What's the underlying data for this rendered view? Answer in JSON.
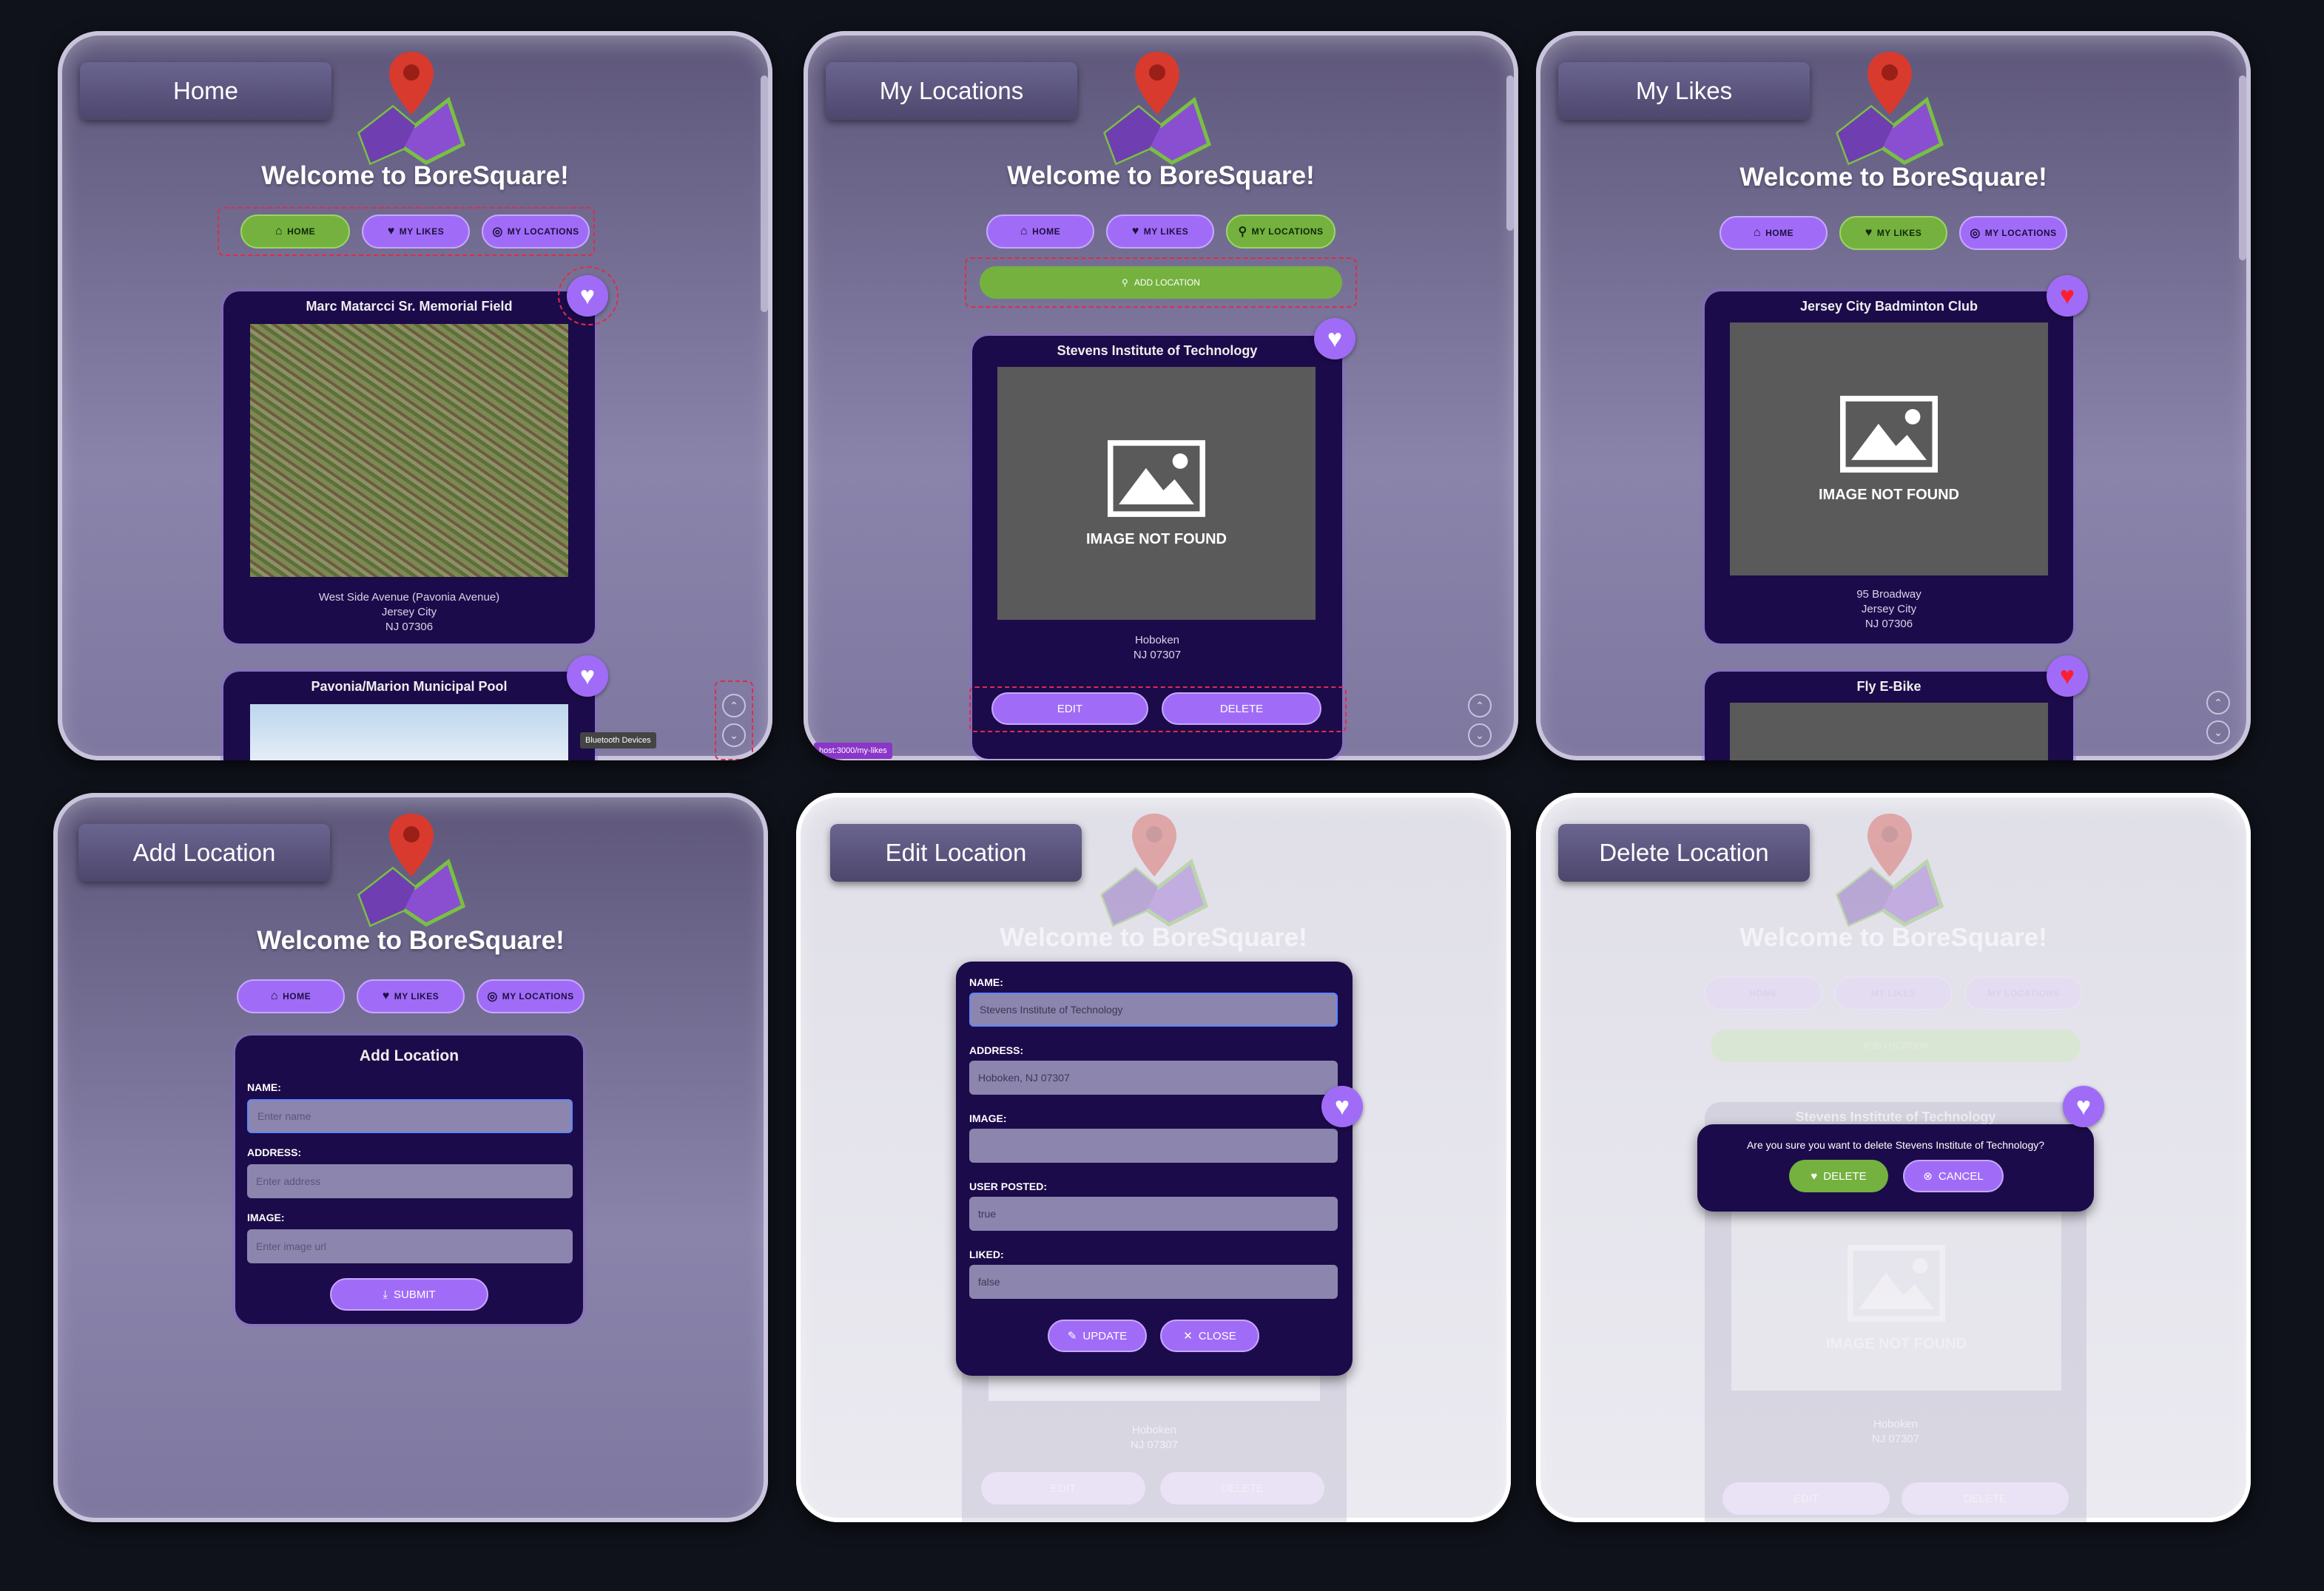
{
  "app_name": "BoreSquare",
  "welcome": "Welcome to BoreSquare!",
  "nav": {
    "home": "HOME",
    "my_likes": "MY LIKES",
    "my_locations": "MY LOCATIONS",
    "add_location": "ADD LOCATION"
  },
  "colors": {
    "accent_purple": "#a06cf7",
    "accent_green": "#74b13f",
    "card_bg": "#1c0b4a",
    "like_red": "#ff1e2e",
    "highlight_dash": "#e02b4a"
  },
  "image_not_found": "IMAGE NOT FOUND",
  "panels": {
    "home": {
      "label": "Home",
      "cards": [
        {
          "title": "Marc Matarcci Sr. Memorial Field",
          "address1": "West Side Avenue (Pavonia Avenue)",
          "address2": "Jersey City",
          "address3": "NJ 07306"
        },
        {
          "title": "Pavonia/Marion Municipal Pool"
        }
      ],
      "tooltip": "Bluetooth Devices"
    },
    "my_locations": {
      "label": "My Locations",
      "card": {
        "title": "Stevens Institute of Technology",
        "address1": "Hoboken",
        "address2": "NJ 07307",
        "edit": "EDIT",
        "delete": "DELETE"
      },
      "status_url": "host:3000/my-likes"
    },
    "my_likes": {
      "label": "My Likes",
      "cards": [
        {
          "title": "Jersey City Badminton Club",
          "address1": "95 Broadway",
          "address2": "Jersey City",
          "address3": "NJ 07306"
        },
        {
          "title": "Fly E-Bike"
        }
      ]
    },
    "add_location": {
      "label": "Add Location",
      "form_title": "Add Location",
      "fields": [
        {
          "label": "NAME:",
          "placeholder": "Enter name"
        },
        {
          "label": "ADDRESS:",
          "placeholder": "Enter address"
        },
        {
          "label": "IMAGE:",
          "placeholder": "Enter image url"
        }
      ],
      "submit": "SUBMIT"
    },
    "edit_location": {
      "label": "Edit Location",
      "fields": [
        {
          "label": "NAME:",
          "value": "Stevens Institute of Technology"
        },
        {
          "label": "ADDRESS:",
          "value": "Hoboken, NJ 07307"
        },
        {
          "label": "IMAGE:",
          "value": ""
        },
        {
          "label": "USER POSTED:",
          "value": "true"
        },
        {
          "label": "LIKED:",
          "value": "false"
        }
      ],
      "update": "UPDATE",
      "close": "CLOSE",
      "bg_address1": "Hoboken",
      "bg_address2": "NJ 07307",
      "bg_edit": "EDIT",
      "bg_delete": "DELETE"
    },
    "delete_location": {
      "label": "Delete Location",
      "question": "Are you sure you want to delete Stevens Institute of Technology?",
      "delete": "DELETE",
      "cancel": "CANCEL",
      "bg_title": "Stevens Institute of Technology",
      "bg_address1": "Hoboken",
      "bg_address2": "NJ 07307",
      "bg_edit": "EDIT",
      "bg_delete": "DELETE"
    }
  }
}
